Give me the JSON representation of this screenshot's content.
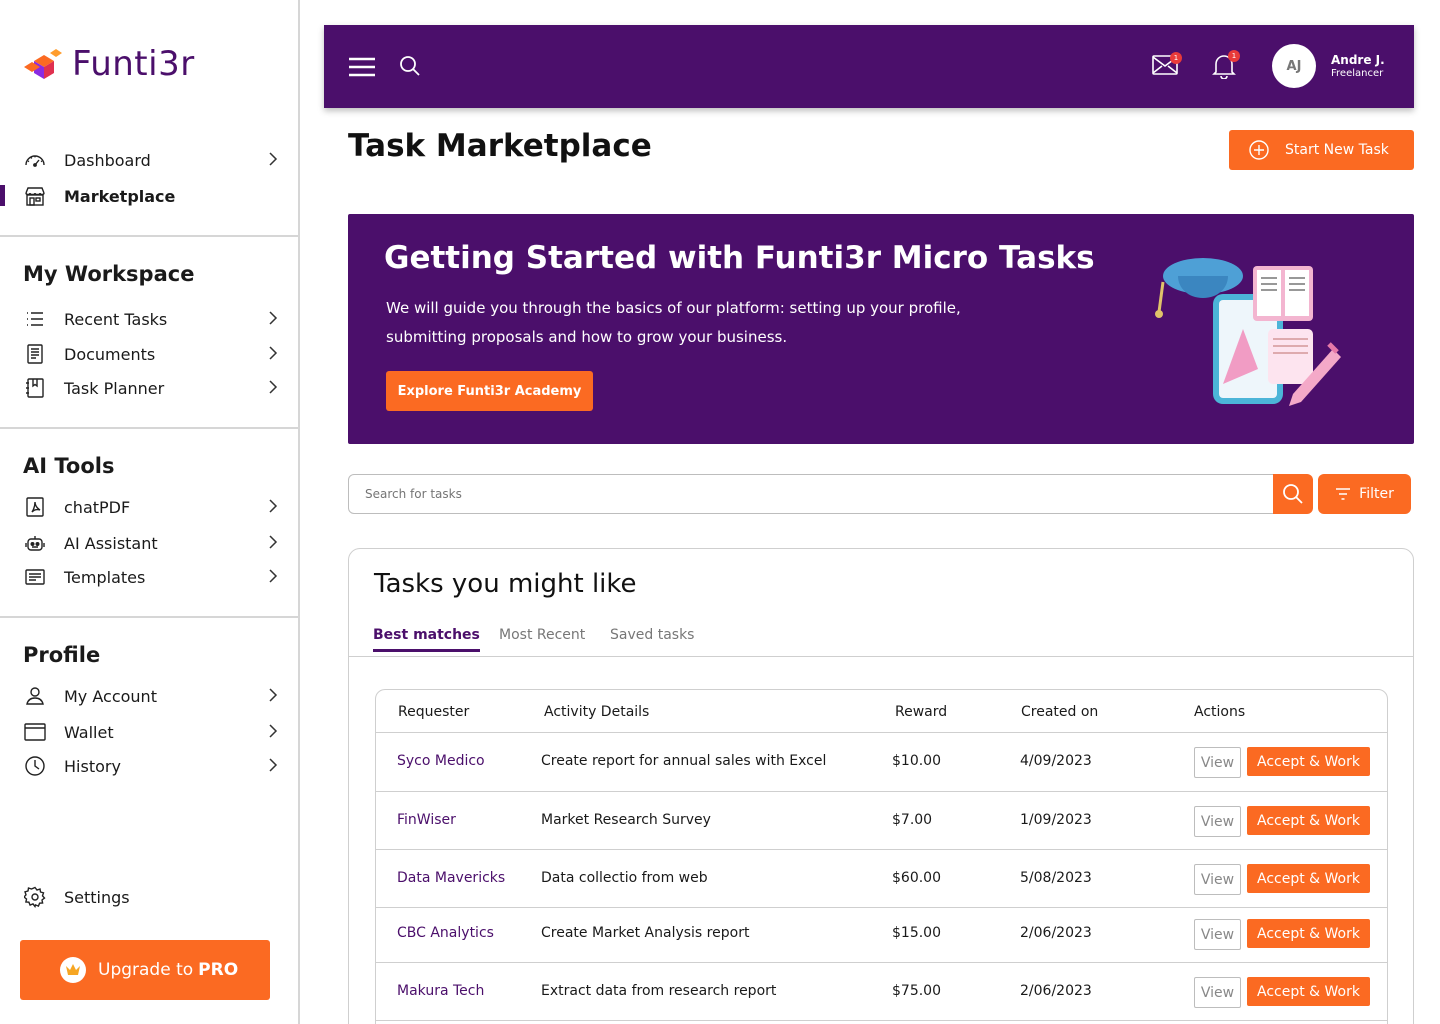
{
  "brand": {
    "name": "Funti3r",
    "accent": "#4b0f6b",
    "orange": "#fb6a22"
  },
  "sidebar": {
    "top_items": [
      {
        "label": "Dashboard",
        "icon": "speedometer-icon"
      },
      {
        "label": "Marketplace",
        "icon": "store-icon"
      }
    ],
    "workspace_title": "My Workspace",
    "workspace_items": [
      {
        "label": "Recent Tasks",
        "icon": "list-icon"
      },
      {
        "label": "Documents",
        "icon": "document-icon"
      },
      {
        "label": "Task Planner",
        "icon": "planner-icon"
      }
    ],
    "ai_title": "AI Tools",
    "ai_items": [
      {
        "label": "chatPDF",
        "icon": "pdf-icon"
      },
      {
        "label": "AI Assistant",
        "icon": "robot-icon"
      },
      {
        "label": "Templates",
        "icon": "template-icon"
      }
    ],
    "profile_title": "Profile",
    "profile_items": [
      {
        "label": "My Account",
        "icon": "user-icon"
      },
      {
        "label": "Wallet",
        "icon": "wallet-icon"
      },
      {
        "label": "History",
        "icon": "clock-icon"
      }
    ],
    "settings_label": "Settings",
    "upgrade_label": "Upgrade to",
    "upgrade_pro": "PRO"
  },
  "header": {
    "mail_badge": "1",
    "bell_badge": "1",
    "avatar_initials": "AJ",
    "user_name": "Andre J.",
    "user_role": "Freelancer"
  },
  "page": {
    "title": "Task Marketplace",
    "start_button": "Start New Task"
  },
  "banner": {
    "title": "Getting Started with Funti3r Micro Tasks",
    "text": "We will guide you through the basics of our platform: setting up your profile, submitting proposals and how to grow your business.",
    "button": "Explore Funti3r Academy"
  },
  "search": {
    "placeholder": "Search for tasks",
    "filter_label": "Filter"
  },
  "tasks": {
    "title": "Tasks you might like",
    "tabs": [
      "Best matches",
      "Most Recent",
      "Saved tasks"
    ],
    "columns": [
      "Requester",
      "Activity Details",
      "Reward",
      "Created on",
      "Actions"
    ],
    "view_label": "View",
    "accept_label": "Accept & Work",
    "rows": [
      {
        "requester": "Syco Medico",
        "details": "Create report for annual sales with Excel",
        "reward": "$10.00",
        "created": "4/09/2023"
      },
      {
        "requester": "FinWiser",
        "details": "Market Research Survey",
        "reward": "$7.00",
        "created": "1/09/2023"
      },
      {
        "requester": "Data Mavericks",
        "details": "Data collectio from web",
        "reward": "$60.00",
        "created": "5/08/2023"
      },
      {
        "requester": "CBC Analytics",
        "details": "Create Market Analysis report",
        "reward": "$15.00",
        "created": "2/06/2023"
      },
      {
        "requester": "Makura Tech",
        "details": "Extract data from research report",
        "reward": "$75.00",
        "created": "2/06/2023"
      }
    ]
  }
}
